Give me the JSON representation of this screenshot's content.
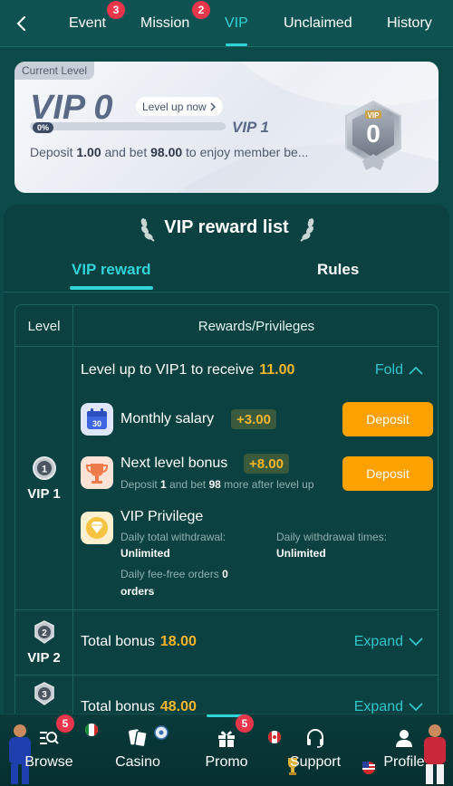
{
  "topnav": {
    "tabs": [
      {
        "label": "Event",
        "badge": "3"
      },
      {
        "label": "Mission",
        "badge": "2"
      },
      {
        "label": "VIP",
        "badge": ""
      },
      {
        "label": "Unclaimed",
        "badge": ""
      },
      {
        "label": "History",
        "badge": ""
      }
    ],
    "active_tab": "VIP"
  },
  "vip_card": {
    "current_level_tag": "Current Level",
    "title": "VIP 0",
    "level_up_label": "Level up now",
    "progress_label": "0%",
    "progress": 0,
    "next_level": "VIP 1",
    "desc_pre": "Deposit ",
    "desc_deposit": "1.00",
    "desc_mid": " and bet ",
    "desc_bet": "98.00",
    "desc_post": " to enjoy member be...",
    "medal_tag": "VIP",
    "medal_number": "0"
  },
  "panel": {
    "title": "VIP reward list",
    "sub_tabs": [
      "VIP reward",
      "Rules"
    ],
    "table_headers": {
      "level": "Level",
      "rewards": "Rewards/Privileges"
    }
  },
  "rows": {
    "vip1": {
      "level_label": "VIP 1",
      "level_num": "1",
      "head_text": "Level up to VIP1 to receive",
      "head_amount": "11.00",
      "toggle_label": "Fold",
      "monthly": {
        "name": "Monthly salary",
        "amount": "+3.00",
        "button": "Deposit",
        "calendar_day": "30"
      },
      "nextlevel": {
        "name": "Next level bonus",
        "amount": "+8.00",
        "button": "Deposit",
        "sub_pre": "Deposit ",
        "sub_deposit": "1",
        "sub_mid": " and bet ",
        "sub_bet": "98",
        "sub_post": " more after level up"
      },
      "privilege": {
        "name": "VIP Privilege",
        "total_withdrawal_label": "Daily total withdrawal:",
        "total_withdrawal_value": "Unlimited",
        "withdrawal_times_label": "Daily withdrawal times:",
        "withdrawal_times_value": "Unlimited",
        "feefree_label": "Daily fee-free orders",
        "feefree_value": "0",
        "feefree_unit": "orders"
      }
    },
    "vip2": {
      "level_label": "VIP 2",
      "level_num": "2",
      "head_text": "Total bonus",
      "head_amount": "18.00",
      "toggle_label": "Expand"
    },
    "vip3": {
      "level_num": "3",
      "head_text": "Total bonus",
      "head_amount": "48.00",
      "toggle_label": "Expand"
    }
  },
  "bottomnav": {
    "items": [
      {
        "label": "Browse",
        "badge": "5",
        "icon": "browse-icon"
      },
      {
        "label": "Casino",
        "badge": "",
        "icon": "cards-icon"
      },
      {
        "label": "Promo",
        "badge": "5",
        "icon": "gift-icon"
      },
      {
        "label": "Support",
        "badge": "",
        "icon": "headset-icon"
      },
      {
        "label": "Profile",
        "badge": "",
        "icon": "user-icon"
      }
    ],
    "active": "Promo"
  },
  "colors": {
    "accent": "#2fd3d8",
    "gold": "#f4b62a",
    "deposit_button": "#fca100",
    "background": "#0d4b4b",
    "badge": "#e8364b"
  }
}
